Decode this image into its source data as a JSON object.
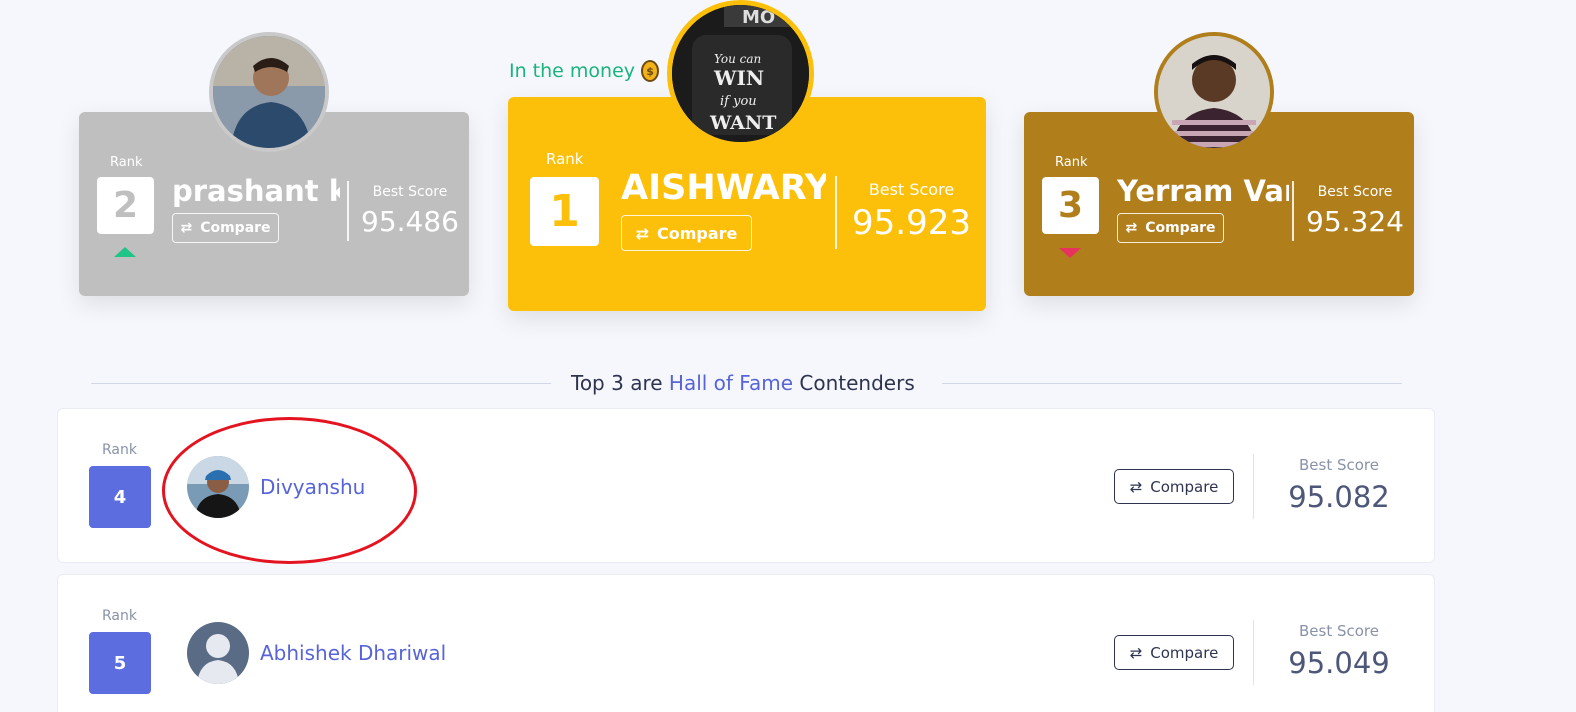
{
  "podium": {
    "money_text": "In the money",
    "money_icon": "money-bag-icon",
    "second": {
      "rank_label": "Rank",
      "rank": "2",
      "name": "prashant k...",
      "compare": "Compare",
      "best_score_label": "Best Score",
      "best_score": "95.486",
      "trend": "up",
      "color": "#bfbfbf"
    },
    "first": {
      "rank_label": "Rank",
      "rank": "1",
      "name": "AISHWARY...",
      "compare": "Compare",
      "best_score_label": "Best Score",
      "best_score": "95.923",
      "color": "#fcc00a"
    },
    "third": {
      "rank_label": "Rank",
      "rank": "3",
      "name": "Yerram Var...",
      "compare": "Compare",
      "best_score_label": "Best Score",
      "best_score": "95.324",
      "trend": "down",
      "color": "#b07e1b"
    }
  },
  "hall_of_fame": {
    "prefix": "Top 3 are",
    "highlight": "Hall of Fame",
    "suffix": "Contenders"
  },
  "rows": [
    {
      "rank_label": "Rank",
      "rank": "4",
      "name": "Divyanshu",
      "compare": "Compare",
      "best_score_label": "Best Score",
      "best_score": "95.082",
      "annotated": true
    },
    {
      "rank_label": "Rank",
      "rank": "5",
      "name": "Abhishek Dhariwal",
      "compare": "Compare",
      "best_score_label": "Best Score",
      "best_score": "95.049"
    }
  ],
  "colors": {
    "accent": "#5c6ddf",
    "trend_up": "#1fc486",
    "trend_down": "#e8315e",
    "annotation": "#e3141f"
  }
}
